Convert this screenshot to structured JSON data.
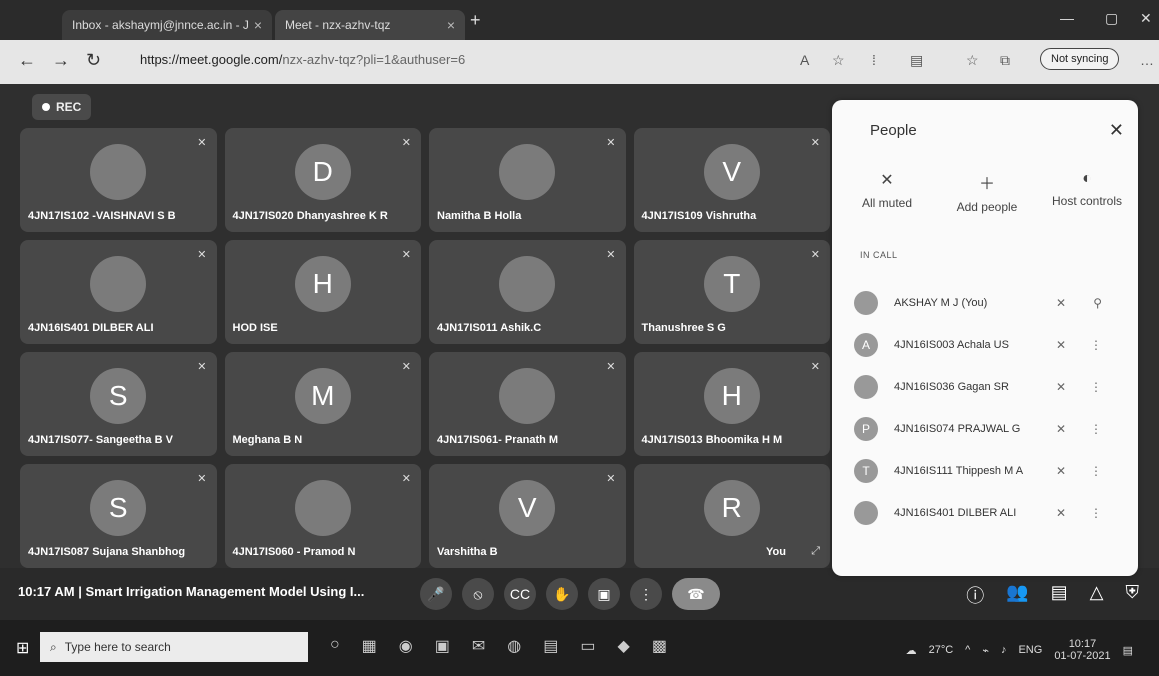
{
  "browser": {
    "tabs": [
      {
        "label": "Inbox - akshaymj@jnnce.ac.in - J"
      },
      {
        "label": "Meet - nzx-azhv-tqz"
      }
    ],
    "address": {
      "url_main": "https://meet.google.com/",
      "url_rest": "nzx-azhv-tqz?pli=1&authuser=6"
    },
    "sync_label": "Not syncing"
  },
  "meet": {
    "rec_label": "REC",
    "tiles": [
      {
        "name": "4JN17IS102 -VAISHNAVI S B",
        "initial": ""
      },
      {
        "name": "4JN17IS020 Dhanyashree K R",
        "initial": "D"
      },
      {
        "name": "Namitha B Holla",
        "initial": ""
      },
      {
        "name": "4JN17IS109 Vishrutha",
        "initial": "V"
      },
      {
        "name": "4JN16IS401 DILBER ALI",
        "initial": ""
      },
      {
        "name": "HOD ISE",
        "initial": "H"
      },
      {
        "name": "4JN17IS011 Ashik.C",
        "initial": ""
      },
      {
        "name": "Thanushree S G",
        "initial": "T"
      },
      {
        "name": "4JN17IS077- Sangeetha B V",
        "initial": "S"
      },
      {
        "name": "Meghana B N",
        "initial": "M"
      },
      {
        "name": "4JN17IS061- Pranath M",
        "initial": ""
      },
      {
        "name": "4JN17IS013 Bhoomika H M",
        "initial": "H"
      },
      {
        "name": "4JN17IS087 Sujana Shanbhog",
        "initial": "S"
      },
      {
        "name": "4JN17IS060 - Pramod N",
        "initial": ""
      },
      {
        "name": "Varshitha B",
        "initial": "V"
      },
      {
        "name": "You",
        "initial": "R"
      }
    ],
    "bottom": {
      "time": "10:17 AM",
      "separator": "|",
      "meeting_title": "Smart Irrigation Management Model Using I..."
    }
  },
  "people_panel": {
    "title": "People",
    "actions": [
      {
        "label": "All muted"
      },
      {
        "label": "Add people"
      },
      {
        "label": "Host controls"
      }
    ],
    "section_label": "IN CALL",
    "people": [
      {
        "name": "AKSHAY M J (You)",
        "initial": ""
      },
      {
        "name": "4JN16IS003 Achala US",
        "initial": "A"
      },
      {
        "name": "4JN16IS036 Gagan SR",
        "initial": ""
      },
      {
        "name": "4JN16IS074 PRAJWAL G",
        "initial": "P"
      },
      {
        "name": "4JN16IS111 Thippesh M A",
        "initial": "T"
      },
      {
        "name": "4JN16IS401 DILBER ALI",
        "initial": ""
      }
    ]
  },
  "taskbar": {
    "search_placeholder": "Type here to search",
    "temperature": "27°C",
    "language": "ENG",
    "time": "10:17",
    "date": "01-07-2021"
  }
}
